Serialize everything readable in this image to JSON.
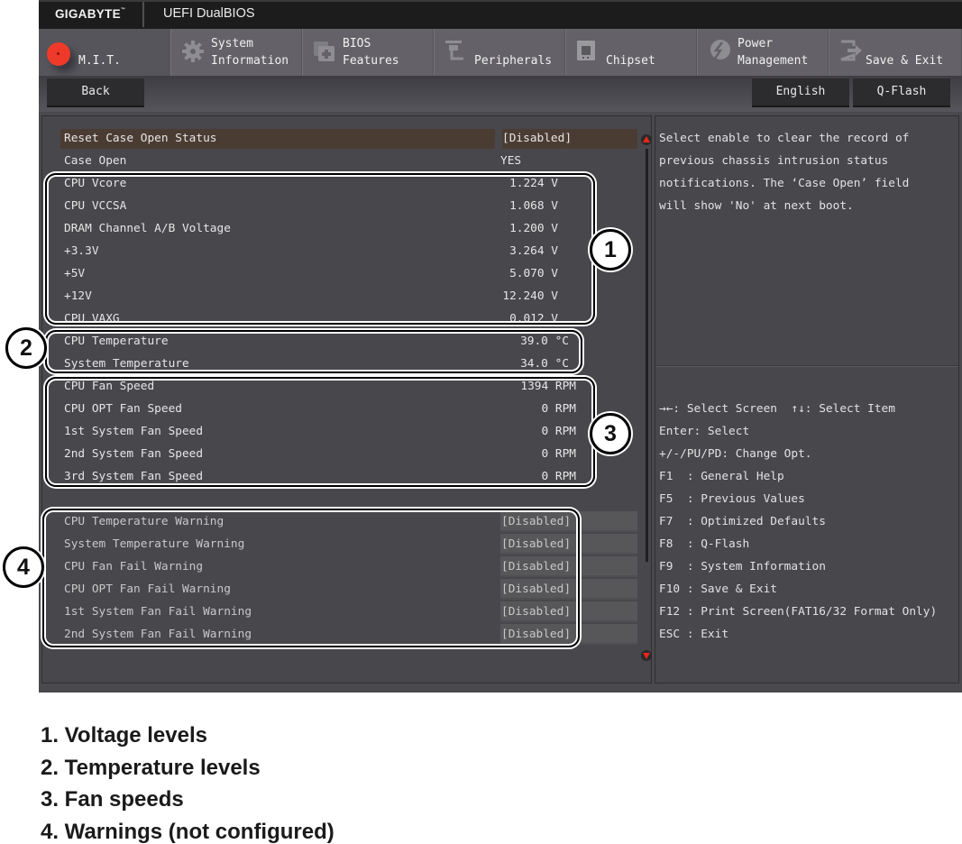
{
  "titlebar": {
    "brand": "GIGABYTE",
    "brand_tm": "™",
    "product": "UEFI DualBIOS"
  },
  "tabs": [
    {
      "label": "M.I.T.",
      "icon": "mit-dot-icon",
      "active": true
    },
    {
      "label": "System\nInformation",
      "icon": "gear-icon",
      "active": false
    },
    {
      "label": "BIOS\nFeatures",
      "icon": "bios-chip-icon",
      "active": false
    },
    {
      "label": "Peripherals",
      "icon": "peripherals-icon",
      "active": false
    },
    {
      "label": "Chipset",
      "icon": "chipset-icon",
      "active": false
    },
    {
      "label": "Power\nManagement",
      "icon": "power-bolt-icon",
      "active": false
    },
    {
      "label": "Save & Exit",
      "icon": "exit-door-icon",
      "active": false
    }
  ],
  "subbar": {
    "back_label": "Back",
    "language_label": "English",
    "qflash_label": "Q-Flash"
  },
  "settings": {
    "reset_case": {
      "label": "Reset Case Open Status",
      "value": "[Disabled]"
    },
    "case_open": {
      "label": "Case Open",
      "value": "YES"
    },
    "voltages": [
      {
        "label": "CPU Vcore",
        "value": "1.224 V"
      },
      {
        "label": "CPU VCCSA",
        "value": "1.068 V"
      },
      {
        "label": "DRAM Channel A/B Voltage",
        "value": "1.200 V"
      },
      {
        "label": "+3.3V",
        "value": "3.264 V"
      },
      {
        "label": "+5V",
        "value": "5.070 V"
      },
      {
        "label": "+12V",
        "value": "12.240 V"
      },
      {
        "label": "CPU VAXG",
        "value": "0.012 V"
      }
    ],
    "temperatures": [
      {
        "label": "CPU Temperature",
        "value": "39.0 °C"
      },
      {
        "label": "System Temperature",
        "value": "34.0 °C"
      }
    ],
    "fans": [
      {
        "label": "CPU Fan Speed",
        "value": "1394 RPM"
      },
      {
        "label": "CPU OPT Fan Speed",
        "value": "0 RPM"
      },
      {
        "label": "1st System Fan Speed",
        "value": "0 RPM"
      },
      {
        "label": "2nd System Fan Speed",
        "value": "0 RPM"
      },
      {
        "label": "3rd System Fan Speed",
        "value": "0 RPM"
      }
    ],
    "warnings": [
      {
        "label": "CPU Temperature Warning",
        "value": "[Disabled]"
      },
      {
        "label": "System Temperature Warning",
        "value": "[Disabled]"
      },
      {
        "label": "CPU Fan Fail Warning",
        "value": "[Disabled]"
      },
      {
        "label": "CPU OPT Fan Fail Warning",
        "value": "[Disabled]"
      },
      {
        "label": "1st System Fan Fail Warning",
        "value": "[Disabled]"
      },
      {
        "label": "2nd System Fan Fail Warning",
        "value": "[Disabled]"
      }
    ]
  },
  "help": {
    "lines": [
      "Select enable to clear the record of",
      "previous chassis intrusion status",
      "notifications. The ‘Case Open’ field",
      "will show 'No' at next boot."
    ],
    "keys": [
      "→←: Select Screen  ↑↓: Select Item",
      "Enter: Select",
      "+/-/PU/PD: Change Opt.",
      "F1  : General Help",
      "F5  : Previous Values",
      "F7  : Optimized Defaults",
      "F8  : Q-Flash",
      "F9  : System Information",
      "F10 : Save & Exit",
      "F12 : Print Screen(FAT16/32 Format Only)",
      "ESC : Exit"
    ]
  },
  "callouts": [
    "1",
    "2",
    "3",
    "4"
  ],
  "legend": [
    "1. Voltage levels",
    "2. Temperature levels",
    "3. Fan speeds",
    "4. Warnings (not configured)"
  ],
  "colors": {
    "accent_red": "#ef3a2a",
    "selected_row": "#4b3c33",
    "panel_bg": "#48474c"
  }
}
